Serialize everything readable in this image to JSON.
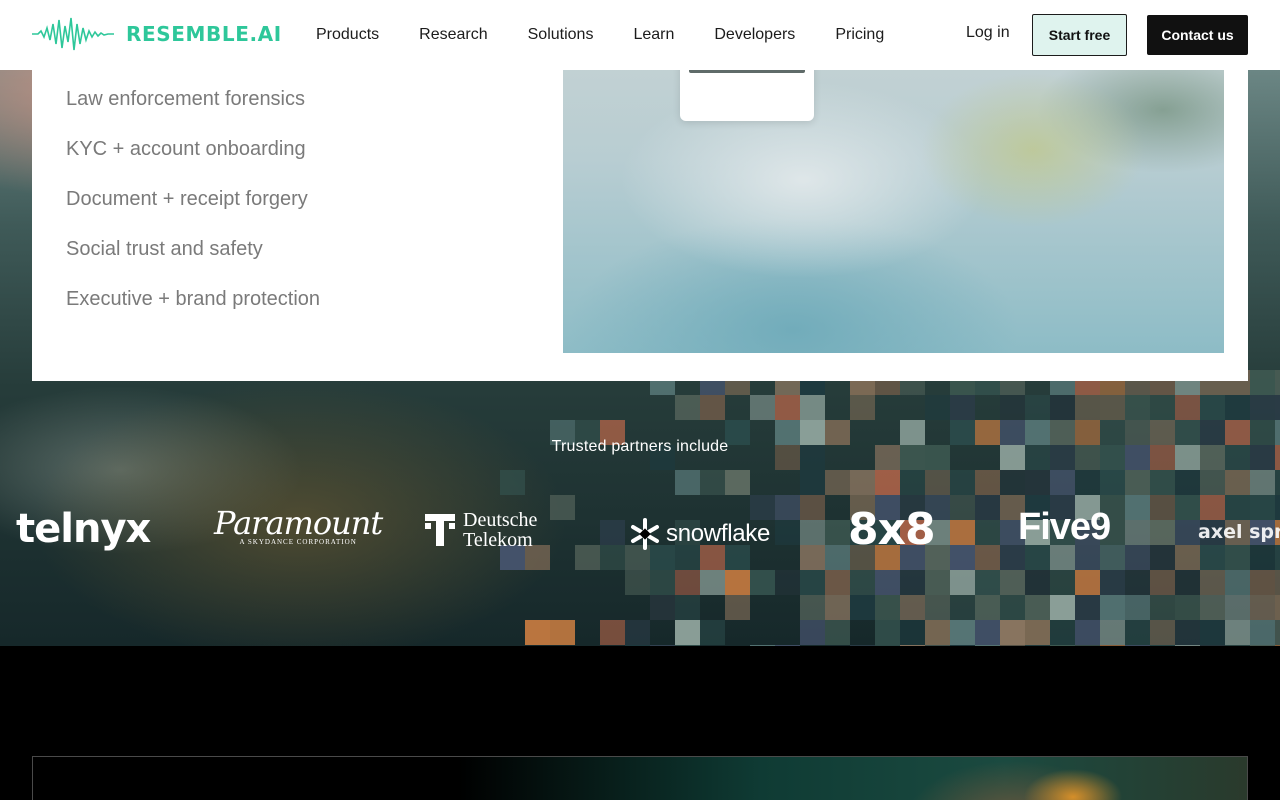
{
  "brand": {
    "name": "RESEMBLE.AI",
    "logo_icon": "soundwave-icon",
    "accent_color": "#2ec79a"
  },
  "nav": {
    "links": [
      "Products",
      "Research",
      "Solutions",
      "Learn",
      "Developers",
      "Pricing"
    ],
    "login_label": "Log in",
    "start_free_label": "Start free",
    "contact_label": "Contact us"
  },
  "usecases": {
    "items": [
      "Law enforcement forensics",
      "KYC + account onboarding",
      "Document + receipt forgery",
      "Social trust and safety",
      "Executive + brand protection"
    ]
  },
  "partners": {
    "title": "Trusted partners include",
    "logos": {
      "telnyx": "telnyx",
      "paramount_main": "Paramount",
      "paramount_sub": "A SKYDANCE CORPORATION",
      "dt_line1": "Deutsche",
      "dt_line2": "Telekom",
      "snowflake": "snowflake",
      "eight_x_eight": "8x8",
      "five9": "Five9",
      "axel": "axel spr"
    }
  }
}
